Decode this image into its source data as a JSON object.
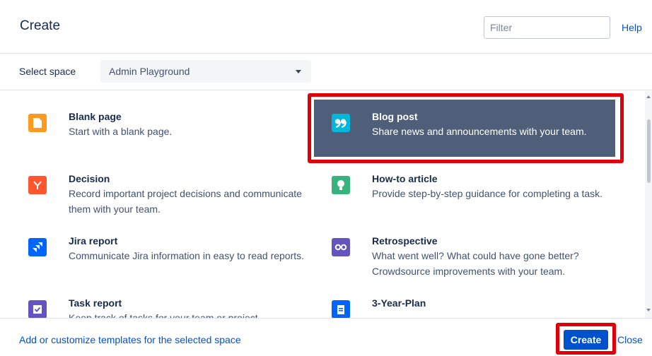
{
  "dialog": {
    "title": "Create",
    "filter_placeholder": "Filter",
    "help_label": "Help"
  },
  "space": {
    "label": "Select space",
    "selected": "Admin Playground"
  },
  "templates": [
    {
      "name": "Blank page",
      "description": "Start with a blank page.",
      "icon": "blank-page-icon",
      "color": "#ff991f"
    },
    {
      "name": "Blog post",
      "description": "Share news and announcements with your team.",
      "icon": "quote-icon",
      "color": "#00b8d9",
      "selected": true
    },
    {
      "name": "Decision",
      "description": "Record important project decisions and communicate them with your team.",
      "icon": "decision-icon",
      "color": "#ff5630"
    },
    {
      "name": "How-to article",
      "description": "Provide step-by-step guidance for completing a task.",
      "icon": "lightbulb-icon",
      "color": "#36b37e"
    },
    {
      "name": "Jira report",
      "description": "Communicate Jira information in easy to read reports.",
      "icon": "jira-icon",
      "color": "#0065ff"
    },
    {
      "name": "Retrospective",
      "description": "What went well? What could have gone better? Crowdsource improvements with your team.",
      "icon": "retrospective-icon",
      "color": "#6554c0"
    },
    {
      "name": "Task report",
      "description": "Keep track of tasks for your team or project",
      "icon": "checkbox-icon",
      "color": "#6554c0"
    },
    {
      "name": "3-Year-Plan",
      "description": "",
      "icon": "document-icon",
      "color": "#0065ff"
    }
  ],
  "footer": {
    "customize_link": "Add or customize templates for the selected space",
    "create_label": "Create",
    "close_label": "Close"
  },
  "colors": {
    "accent": "#0052cc",
    "selected_bg": "#505f79",
    "highlight_frame": "#e0000a"
  }
}
